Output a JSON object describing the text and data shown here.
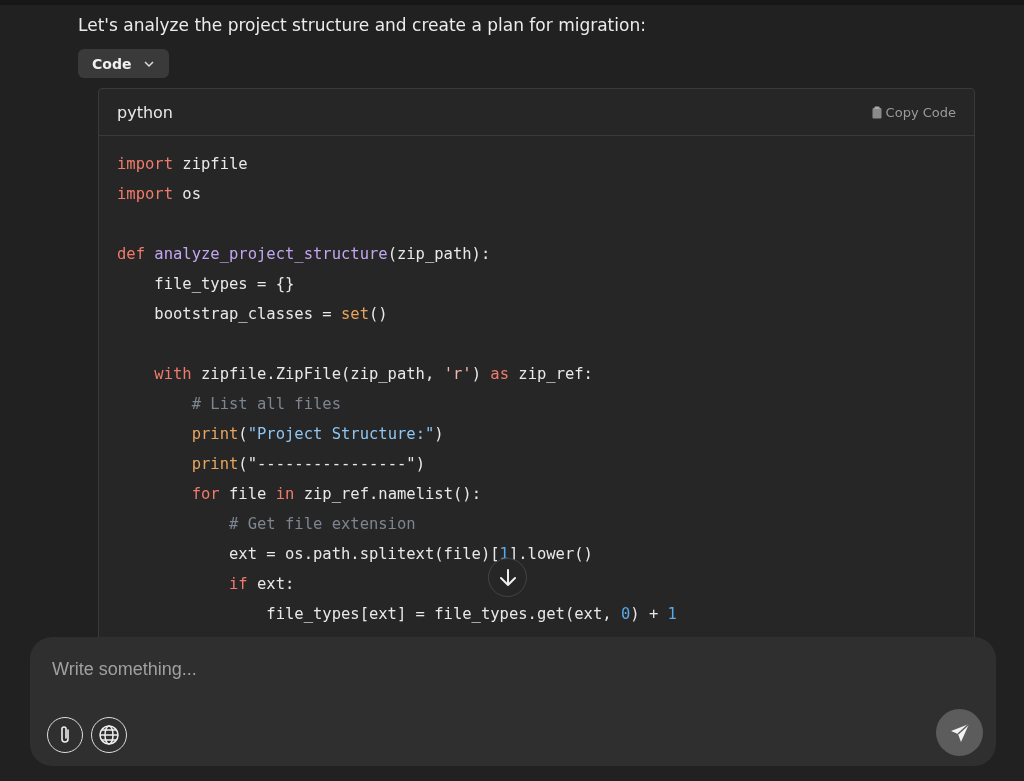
{
  "message": "Let's analyze the project structure and create a plan for migration:",
  "code_toggle": {
    "label": "Code",
    "expanded": false
  },
  "code_block": {
    "language": "python",
    "copy_label": "Copy Code",
    "lines": [
      {
        "tokens": [
          {
            "text": "import",
            "kind": "keyword"
          },
          {
            "text": " zipfile",
            "kind": "plain"
          }
        ]
      },
      {
        "tokens": [
          {
            "text": "import",
            "kind": "keyword"
          },
          {
            "text": " os",
            "kind": "plain"
          }
        ]
      },
      {
        "kind": "blank"
      },
      {
        "tokens": [
          {
            "text": "def ",
            "kind": "keyword"
          },
          {
            "text": "analyze_project_structure",
            "kind": "function"
          },
          {
            "text": "(zip_path):",
            "kind": "plain"
          }
        ]
      },
      {
        "tokens": [
          {
            "text": "    file_types = {}",
            "kind": "plain"
          }
        ]
      },
      {
        "tokens": [
          {
            "text": "    bootstrap_classes = ",
            "kind": "plain"
          },
          {
            "text": "set",
            "kind": "builtin"
          },
          {
            "text": "()",
            "kind": "plain"
          }
        ]
      },
      {
        "kind": "blank"
      },
      {
        "tokens": [
          {
            "text": "    with",
            "kind": "keyword"
          },
          {
            "text": " zipfile.ZipFile(zip_path, ",
            "kind": "plain"
          },
          {
            "text": "'r'",
            "kind": "char"
          },
          {
            "text": ") ",
            "kind": "plain"
          },
          {
            "text": "as",
            "kind": "keyword"
          },
          {
            "text": " zip_ref:",
            "kind": "plain"
          }
        ]
      },
      {
        "tokens": [
          {
            "text": "        # List all files",
            "kind": "comment"
          }
        ]
      },
      {
        "tokens": [
          {
            "text": "        print",
            "kind": "builtin"
          },
          {
            "text": "(",
            "kind": "plain"
          },
          {
            "text": "\"Project Structure:\"",
            "kind": "string"
          },
          {
            "text": ")",
            "kind": "plain"
          }
        ]
      },
      {
        "tokens": [
          {
            "text": "        print",
            "kind": "builtin"
          },
          {
            "text": "(\"----------------\")",
            "kind": "plain"
          }
        ]
      },
      {
        "tokens": [
          {
            "text": "        for",
            "kind": "keyword"
          },
          {
            "text": " file ",
            "kind": "plain"
          },
          {
            "text": "in",
            "kind": "keyword"
          },
          {
            "text": " zip_ref.namelist():",
            "kind": "plain"
          }
        ]
      },
      {
        "tokens": [
          {
            "text": "            # Get file extension",
            "kind": "comment"
          }
        ]
      },
      {
        "tokens": [
          {
            "text": "            ext = os.path.splitext(file)[",
            "kind": "plain"
          },
          {
            "text": "1",
            "kind": "number"
          },
          {
            "text": "].lower()",
            "kind": "plain"
          }
        ]
      },
      {
        "tokens": [
          {
            "text": "            if",
            "kind": "keyword"
          },
          {
            "text": " ext:",
            "kind": "plain"
          }
        ]
      },
      {
        "tokens": [
          {
            "text": "                file_types[ext] = file_types.get(ext, ",
            "kind": "plain"
          },
          {
            "text": "0",
            "kind": "number"
          },
          {
            "text": ") + ",
            "kind": "plain"
          },
          {
            "text": "1",
            "kind": "number"
          }
        ]
      }
    ]
  },
  "composer": {
    "placeholder": "Write something..."
  }
}
